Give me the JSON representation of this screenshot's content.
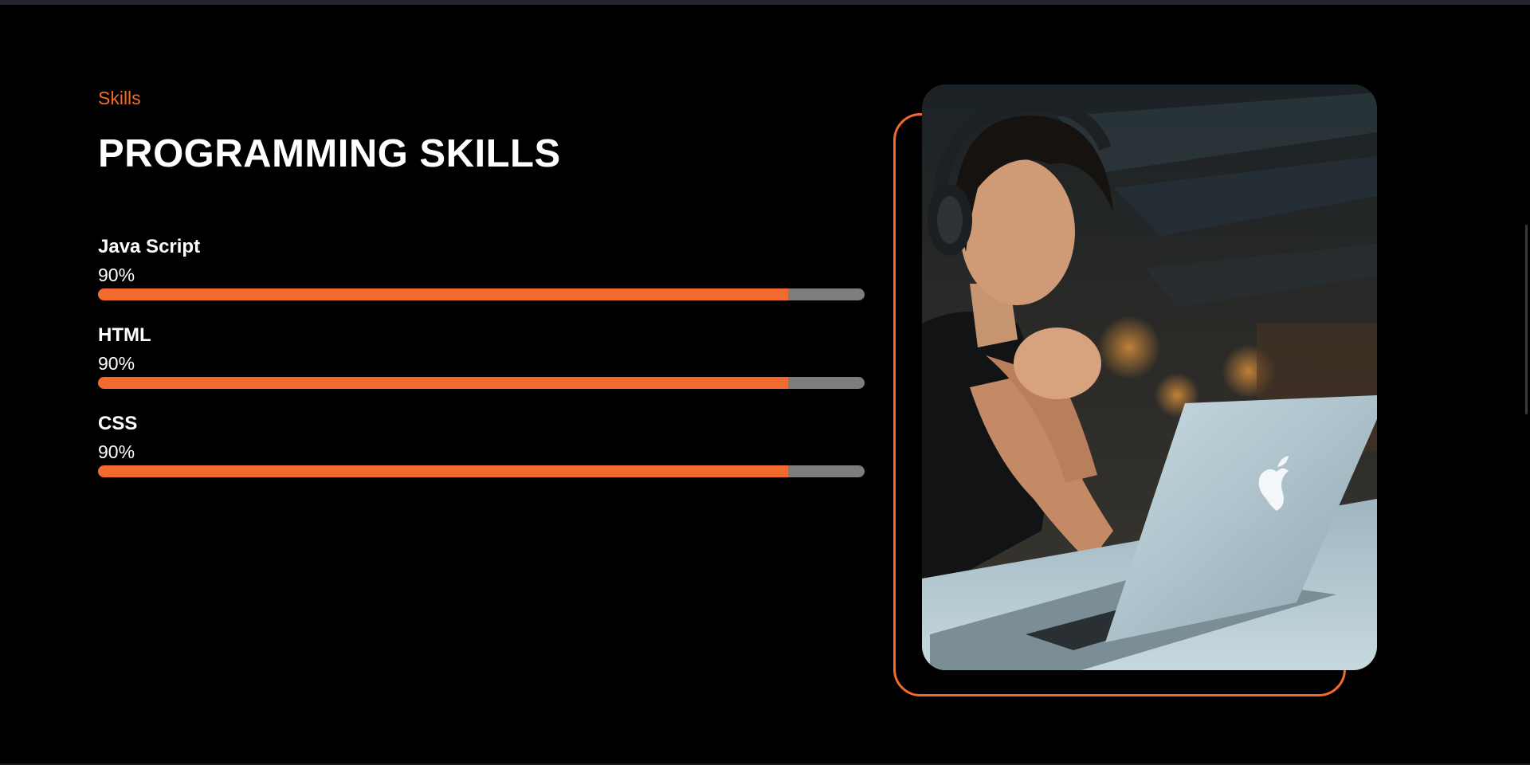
{
  "section": {
    "eyebrow": "Skills",
    "title": "PROGRAMMING SKILLS"
  },
  "skills": [
    {
      "name": "Java Script",
      "percent_label": "90%",
      "level": 0.9
    },
    {
      "name": "HTML",
      "percent_label": "90%",
      "level": 0.9
    },
    {
      "name": "CSS",
      "percent_label": "90%",
      "level": 0.9
    }
  ],
  "photo": {
    "subject": "man-with-headphones-at-laptop"
  },
  "colors": {
    "accent": "#f26a2e",
    "track": "#7d7d7d",
    "background": "#000000",
    "text": "#ffffff"
  }
}
